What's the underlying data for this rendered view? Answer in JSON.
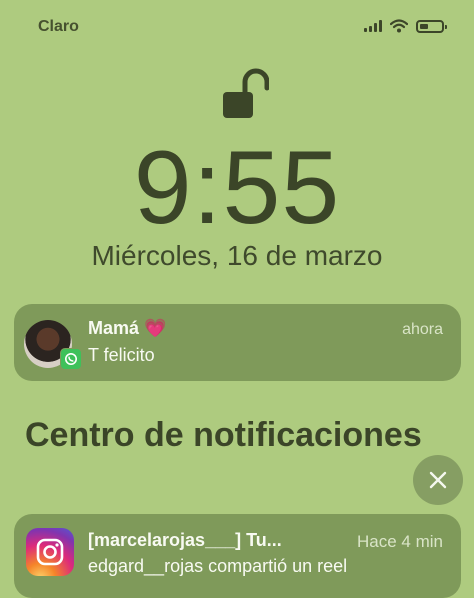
{
  "status_bar": {
    "carrier": "Claro",
    "icons": [
      "cellular-signal-icon",
      "wifi-icon",
      "battery-icon"
    ]
  },
  "lock_screen": {
    "lock_icon": "unlocked-padlock-icon",
    "time": "9:55",
    "date": "Miércoles, 16 de marzo"
  },
  "notifications": [
    {
      "app": "WhatsApp",
      "app_icon": "whatsapp-icon",
      "sender": "Mamá 💗",
      "time": "ahora",
      "message": "T felicito"
    }
  ],
  "notification_center": {
    "title": "Centro de notificaciones",
    "close_icon": "close-icon",
    "items": [
      {
        "app": "Instagram",
        "app_icon": "instagram-icon",
        "title": "[marcelarojas___] Tu...",
        "time": "Hace 4 min",
        "message": "edgard__rojas compartió un reel"
      }
    ]
  },
  "colors": {
    "background": "#aecb7f",
    "notification_bg": "#7f9a5a",
    "text_dark": "#3b4528"
  }
}
